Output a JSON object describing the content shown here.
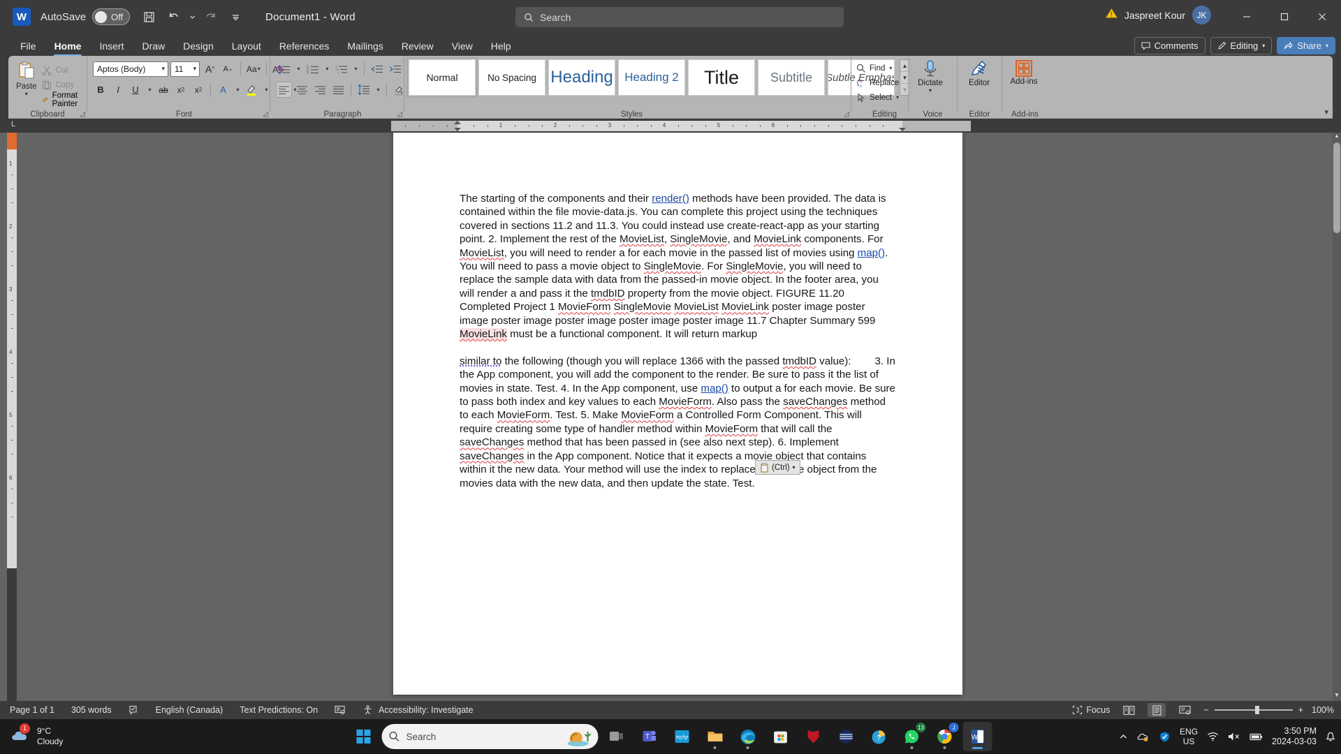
{
  "titlebar": {
    "app_logo": "word-logo",
    "autosave_label": "AutoSave",
    "autosave_state": "Off",
    "save_icon": "save-icon",
    "undo_icon": "undo-icon",
    "redo_icon": "redo-icon",
    "customize_icon": "customize-quick-access-icon",
    "document_title": "Document1  -  Word",
    "search_placeholder": "Search",
    "search_icon": "search-icon",
    "warning_icon": "warning-icon",
    "account_name": "Jaspreet Kour",
    "avatar_initials": "JK",
    "minimize": "minimize-icon",
    "maximize": "maximize-icon",
    "close": "close-icon"
  },
  "tabs": [
    {
      "label": "File",
      "active": false
    },
    {
      "label": "Home",
      "active": true
    },
    {
      "label": "Insert",
      "active": false
    },
    {
      "label": "Draw",
      "active": false
    },
    {
      "label": "Design",
      "active": false
    },
    {
      "label": "Layout",
      "active": false
    },
    {
      "label": "References",
      "active": false
    },
    {
      "label": "Mailings",
      "active": false
    },
    {
      "label": "Review",
      "active": false
    },
    {
      "label": "View",
      "active": false
    },
    {
      "label": "Help",
      "active": false
    }
  ],
  "tab_actions": {
    "comments": "Comments",
    "editing": "Editing",
    "share": "Share"
  },
  "ribbon": {
    "clipboard": {
      "group_label": "Clipboard",
      "paste": "Paste",
      "cut": "Cut",
      "copy": "Copy",
      "format_painter": "Format Painter"
    },
    "font": {
      "group_label": "Font",
      "font_name": "Aptos (Body)",
      "font_size": "11",
      "grow_font": "A",
      "shrink_font": "A",
      "change_case": "Aa",
      "clear_formatting": "clear-formatting-icon",
      "bold": "B",
      "italic": "I",
      "underline": "U",
      "strikethrough": "ab",
      "subscript": "x",
      "superscript": "x",
      "text_effects": "A",
      "highlight": "highlight-icon",
      "font_color": "A"
    },
    "paragraph": {
      "group_label": "Paragraph",
      "bullets": "bullets-icon",
      "numbering": "numbering-icon",
      "multilevel": "multilevel-list-icon",
      "decrease_indent": "decrease-indent-icon",
      "increase_indent": "increase-indent-icon",
      "sort": "sort-icon",
      "show_marks": "¶",
      "align_left": "align-left-icon",
      "align_center": "align-center-icon",
      "align_right": "align-right-icon",
      "justify": "justify-icon",
      "line_spacing": "line-spacing-icon",
      "shading": "shading-icon",
      "borders": "borders-icon"
    },
    "styles": {
      "group_label": "Styles",
      "items": [
        {
          "label": "Normal",
          "class": "sb-normal"
        },
        {
          "label": "No Spacing",
          "class": "sb-nospace"
        },
        {
          "label": "Heading",
          "class": "sb-h1"
        },
        {
          "label": "Heading 2",
          "class": "sb-h2"
        },
        {
          "label": "Title",
          "class": "sb-title"
        },
        {
          "label": "Subtitle",
          "class": "sb-sub"
        },
        {
          "label": "Subtle Emphas",
          "class": "sb-emph"
        }
      ]
    },
    "editing": {
      "group_label": "Editing",
      "find": "Find",
      "replace": "Replace",
      "select": "Select"
    },
    "voice": {
      "group_label": "Voice",
      "dictate": "Dictate"
    },
    "editor": {
      "group_label": "Editor",
      "editor": "Editor"
    },
    "addins": {
      "group_label": "Add-ins",
      "addins": "Add-ins"
    }
  },
  "ruler": {
    "corner_label": "L",
    "numbers": [
      "1",
      "2",
      "3",
      "4",
      "5",
      "6"
    ]
  },
  "vruler": {
    "numbers": [
      "1",
      "2",
      "3",
      "4",
      "5",
      "6"
    ]
  },
  "document": {
    "paragraph1": [
      {
        "t": "The starting of the components and their ",
        "s": ""
      },
      {
        "t": "render()",
        "s": "link"
      },
      {
        "t": " methods have been provided. The data is contained within the file movie-data.js. You can complete this project using the techniques covered in sections 11.2 and 11.3. You could instead use create-react-app as your starting point. 2. Implement the rest of the ",
        "s": ""
      },
      {
        "t": "MovieList",
        "s": "sp"
      },
      {
        "t": ", ",
        "s": ""
      },
      {
        "t": "SingleMovie",
        "s": "sp"
      },
      {
        "t": ", and ",
        "s": ""
      },
      {
        "t": "MovieLink",
        "s": "sp"
      },
      {
        "t": " components. For ",
        "s": ""
      },
      {
        "t": "MovieList",
        "s": "sp"
      },
      {
        "t": ", you will need to render a for each movie in the passed list of movies using ",
        "s": ""
      },
      {
        "t": "map()",
        "s": "link"
      },
      {
        "t": ". You will need to pass a movie object to ",
        "s": ""
      },
      {
        "t": "SingleMovie",
        "s": "sp"
      },
      {
        "t": ". For ",
        "s": ""
      },
      {
        "t": "SingleMovie",
        "s": "sp"
      },
      {
        "t": ", you will need to replace the sample data with data from the passed-in movie object. In the footer area, you will render a and pass it the ",
        "s": ""
      },
      {
        "t": "tmdbID",
        "s": "sp"
      },
      {
        "t": " property from the movie object. FIGURE 11.20 Completed Project 1 ",
        "s": ""
      },
      {
        "t": "MovieForm",
        "s": "sp"
      },
      {
        "t": " ",
        "s": ""
      },
      {
        "t": "SingleMovie",
        "s": "sp"
      },
      {
        "t": " ",
        "s": ""
      },
      {
        "t": "MovieList",
        "s": "sp"
      },
      {
        "t": " ",
        "s": ""
      },
      {
        "t": "MovieLink",
        "s": "sp"
      },
      {
        "t": " poster image poster image poster image poster image poster image poster image 11.7 Chapter Summary 599 ",
        "s": ""
      },
      {
        "t": "MovieLink",
        "s": "sp hl"
      },
      {
        "t": " must be a functional component. It will return markup",
        "s": ""
      }
    ],
    "paragraph2": [
      {
        "t": "similar to",
        "s": "gr"
      },
      {
        "t": " the following (though you will replace 1366 with the passed ",
        "s": ""
      },
      {
        "t": "tmdbID",
        "s": "sp"
      },
      {
        "t": " value):",
        "s": ""
      },
      {
        "t": "GAP",
        "s": "gap"
      },
      {
        "t": "3. In the App component, you will add the component to the render. Be sure to pass it the list of movies in state. Test. 4. In the App component, use ",
        "s": ""
      },
      {
        "t": "map()",
        "s": "link"
      },
      {
        "t": " to output a for each movie. Be sure to pass both index and key values to each ",
        "s": ""
      },
      {
        "t": "MovieForm",
        "s": "sp"
      },
      {
        "t": ". Also pass the ",
        "s": ""
      },
      {
        "t": "saveChanges",
        "s": "sp"
      },
      {
        "t": " method to each ",
        "s": ""
      },
      {
        "t": "MovieForm",
        "s": "sp"
      },
      {
        "t": ". Test. 5. Make ",
        "s": ""
      },
      {
        "t": "MovieForm",
        "s": "sp"
      },
      {
        "t": " a Controlled Form Component. This will require creating some type of handler method within ",
        "s": ""
      },
      {
        "t": "MovieForm",
        "s": "sp"
      },
      {
        "t": " that will call the ",
        "s": ""
      },
      {
        "t": "saveChanges",
        "s": "sp"
      },
      {
        "t": " method that has been passed in (see also next step). 6. Implement ",
        "s": ""
      },
      {
        "t": "saveChanges",
        "s": "sp"
      },
      {
        "t": " in the App component. Notice that it expects a movie object that contains within it the new data. Your method will use the index to replace the movie object from the movies data with the new data, and then update the state. Test.",
        "s": ""
      }
    ],
    "paste_options": {
      "icon": "paste-options-icon",
      "label": "(Ctrl)"
    }
  },
  "statusbar": {
    "page": "Page 1 of 1",
    "words": "305 words",
    "proofing_icon": "proofing-icon",
    "language": "English (Canada)",
    "text_predictions": "Text Predictions: On",
    "dictation_icon": "display-settings-icon",
    "accessibility": "Accessibility: Investigate",
    "focus": "Focus",
    "view_read": "read-mode-icon",
    "view_print": "print-layout-icon",
    "view_web": "web-layout-icon",
    "zoom_out": "−",
    "zoom_in": "+",
    "zoom_level": "100%"
  },
  "taskbar": {
    "weather_temp": "9°C",
    "weather_cond": "Cloudy",
    "weather_badge": "1",
    "start_icon": "windows-start-icon",
    "search_placeholder": "Search",
    "search_icon": "search-icon",
    "apps": [
      {
        "name": "task-view-icon",
        "running": false
      },
      {
        "name": "teams-icon",
        "running": false
      },
      {
        "name": "myhp-icon",
        "running": false
      },
      {
        "name": "file-explorer-icon",
        "running": true
      },
      {
        "name": "edge-icon",
        "running": true
      },
      {
        "name": "microsoft-store-icon",
        "running": false
      },
      {
        "name": "mcafee-icon",
        "running": false
      },
      {
        "name": "zoom-icon",
        "running": false
      },
      {
        "name": "help-icon",
        "running": false
      },
      {
        "name": "whatsapp-icon",
        "running": true,
        "badge": "13"
      },
      {
        "name": "chrome-icon",
        "running": true,
        "badge": "J"
      },
      {
        "name": "word-icon",
        "running": true,
        "active": true
      }
    ],
    "tray": {
      "chevron": "show-hidden-icons-icon",
      "onedrive_icon": "onedrive-icon",
      "defender_icon": "windows-security-icon",
      "lang_line1": "ENG",
      "lang_line2": "US",
      "wifi_icon": "wifi-icon",
      "volume_icon": "volume-muted-icon",
      "battery_icon": "battery-icon",
      "time": "3:50 PM",
      "date": "2024-03-03",
      "notification_icon": "notifications-icon"
    }
  }
}
